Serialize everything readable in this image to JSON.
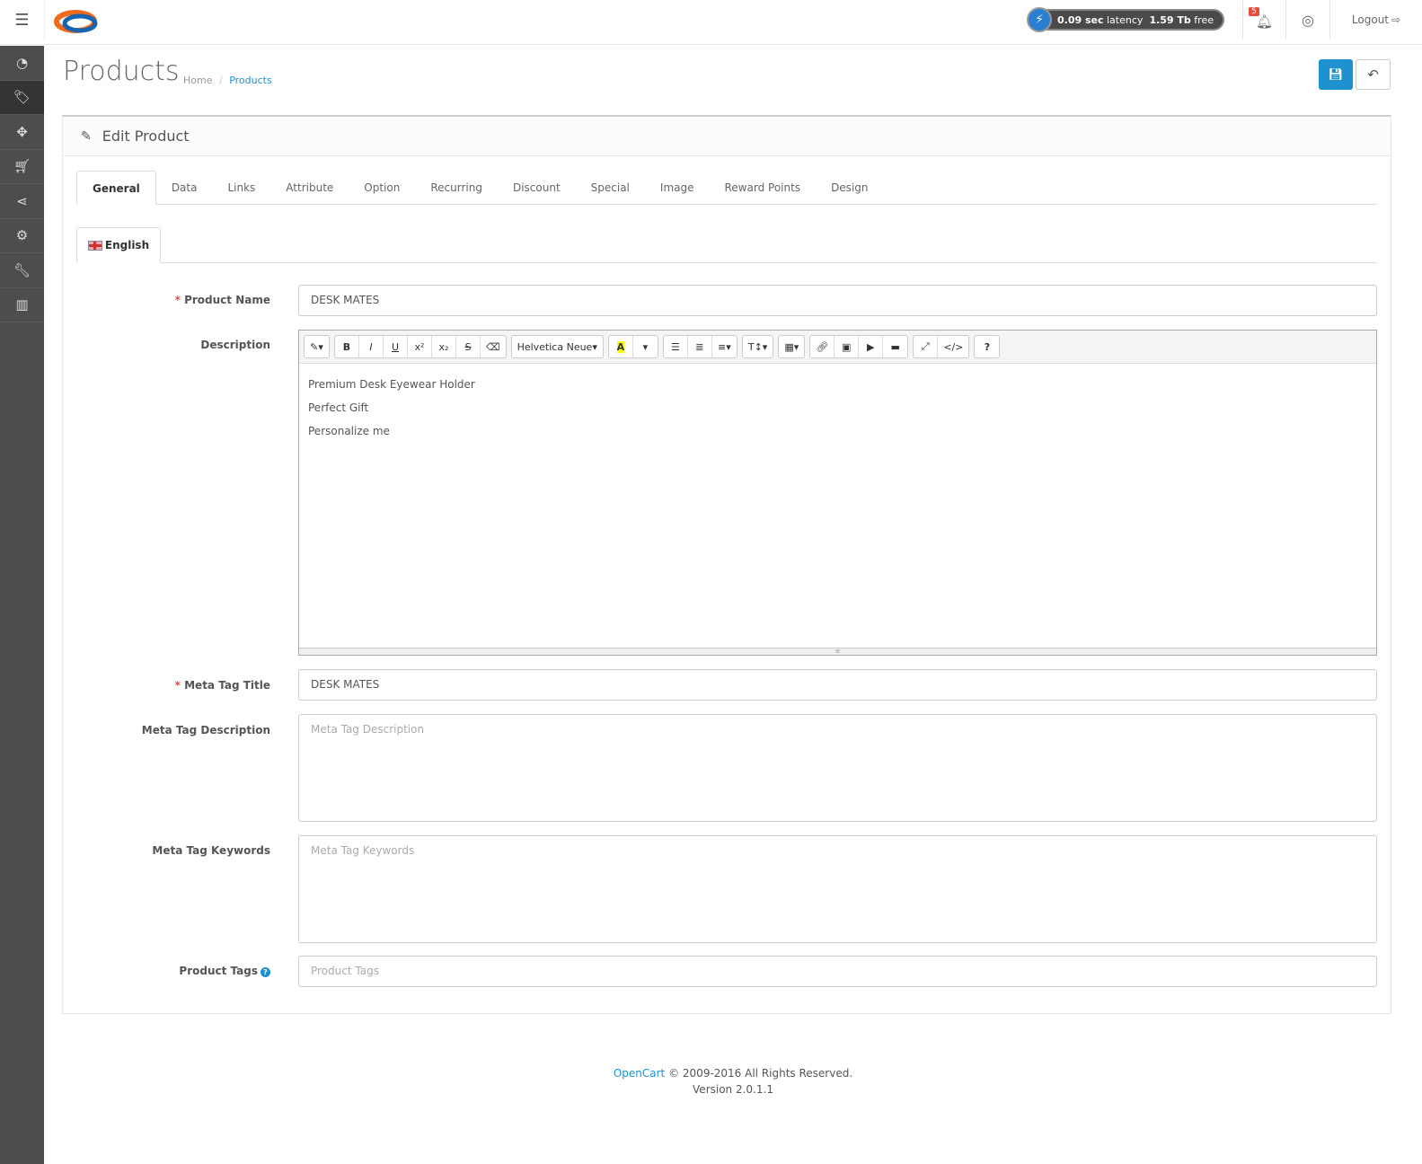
{
  "header": {
    "latency_value": "0.09 sec",
    "latency_label": "latency",
    "free_value": "1.59 Tb",
    "free_label": "free",
    "notification_count": "5",
    "logout": "Logout"
  },
  "sidebar": {
    "items": [
      "dashboard",
      "catalog",
      "extensions",
      "sales",
      "marketing",
      "system",
      "tools",
      "reports"
    ]
  },
  "page": {
    "title": "Products",
    "breadcrumb": [
      "Home",
      "Products"
    ]
  },
  "panel": {
    "title": "Edit Product"
  },
  "tabs": [
    "General",
    "Data",
    "Links",
    "Attribute",
    "Option",
    "Recurring",
    "Discount",
    "Special",
    "Image",
    "Reward Points",
    "Design"
  ],
  "language_tab": "English",
  "form": {
    "product_name": {
      "label": "Product Name",
      "value": "DESK MATES"
    },
    "description": {
      "label": "Description",
      "font": "Helvetica Neue",
      "lines": [
        "Premium Desk Eyewear Holder",
        "Perfect Gift",
        "Personalize me"
      ]
    },
    "meta_title": {
      "label": "Meta Tag Title",
      "value": "DESK MATES"
    },
    "meta_description": {
      "label": "Meta Tag Description",
      "placeholder": "Meta Tag Description"
    },
    "meta_keywords": {
      "label": "Meta Tag Keywords",
      "placeholder": "Meta Tag Keywords"
    },
    "product_tags": {
      "label": "Product Tags",
      "placeholder": "Product Tags"
    }
  },
  "footer": {
    "brand": "OpenCart",
    "copyright": "© 2009-2016 All Rights Reserved.",
    "version": "Version 2.0.1.1"
  },
  "colors": {
    "primary": "#1e91cf",
    "sidebar": "#4d4d4d",
    "required": "#e74c3c"
  }
}
